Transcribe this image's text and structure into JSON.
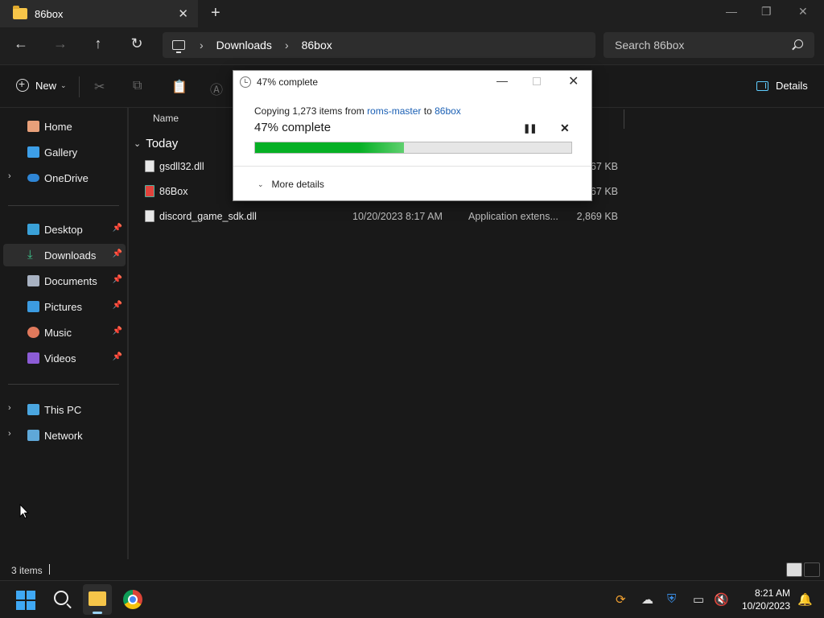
{
  "window": {
    "tab_title": "86box"
  },
  "address": {
    "breadcrumb": [
      "Downloads",
      "86box"
    ],
    "search_placeholder": "Search 86box"
  },
  "commandbar": {
    "new_label": "New",
    "details_label": "Details"
  },
  "sidebar": {
    "top_items": [
      {
        "label": "Home",
        "icon": "home-icon"
      },
      {
        "label": "Gallery",
        "icon": "gallery-icon"
      },
      {
        "label": "OneDrive",
        "icon": "cloud-icon"
      }
    ],
    "pinned_items": [
      {
        "label": "Desktop",
        "icon": "desktop-icon"
      },
      {
        "label": "Downloads",
        "icon": "download-icon"
      },
      {
        "label": "Documents",
        "icon": "documents-icon"
      },
      {
        "label": "Pictures",
        "icon": "pictures-icon"
      },
      {
        "label": "Music",
        "icon": "music-icon"
      },
      {
        "label": "Videos",
        "icon": "videos-icon"
      }
    ],
    "bottom_items": [
      {
        "label": "This PC",
        "icon": "pc-icon"
      },
      {
        "label": "Network",
        "icon": "network-icon"
      }
    ]
  },
  "content": {
    "column_name": "Name",
    "group_label": "Today",
    "rows": [
      {
        "name": "gsdll32.dll",
        "date": "",
        "type": "",
        "size": "867 KB"
      },
      {
        "name": "86Box",
        "date": "",
        "type": "",
        "size": "467 KB"
      },
      {
        "name": "discord_game_sdk.dll",
        "date": "10/20/2023 8:17 AM",
        "type": "Application extens...",
        "size": "2,869 KB"
      }
    ]
  },
  "status": {
    "item_count": "3 items"
  },
  "taskbar": {
    "time": "8:21 AM",
    "date": "10/20/2023"
  },
  "dialog": {
    "title": "47% complete",
    "copying_prefix": "Copying 1,273 items from ",
    "source": "roms-master",
    "connector": " to ",
    "destination": "86box",
    "progress_label": "47% complete",
    "progress_percent": 47,
    "more_details": "More details"
  },
  "colors": {
    "progress_green": "#06b025",
    "accent_blue": "#60cdff",
    "link_blue": "#1a5fb4"
  }
}
